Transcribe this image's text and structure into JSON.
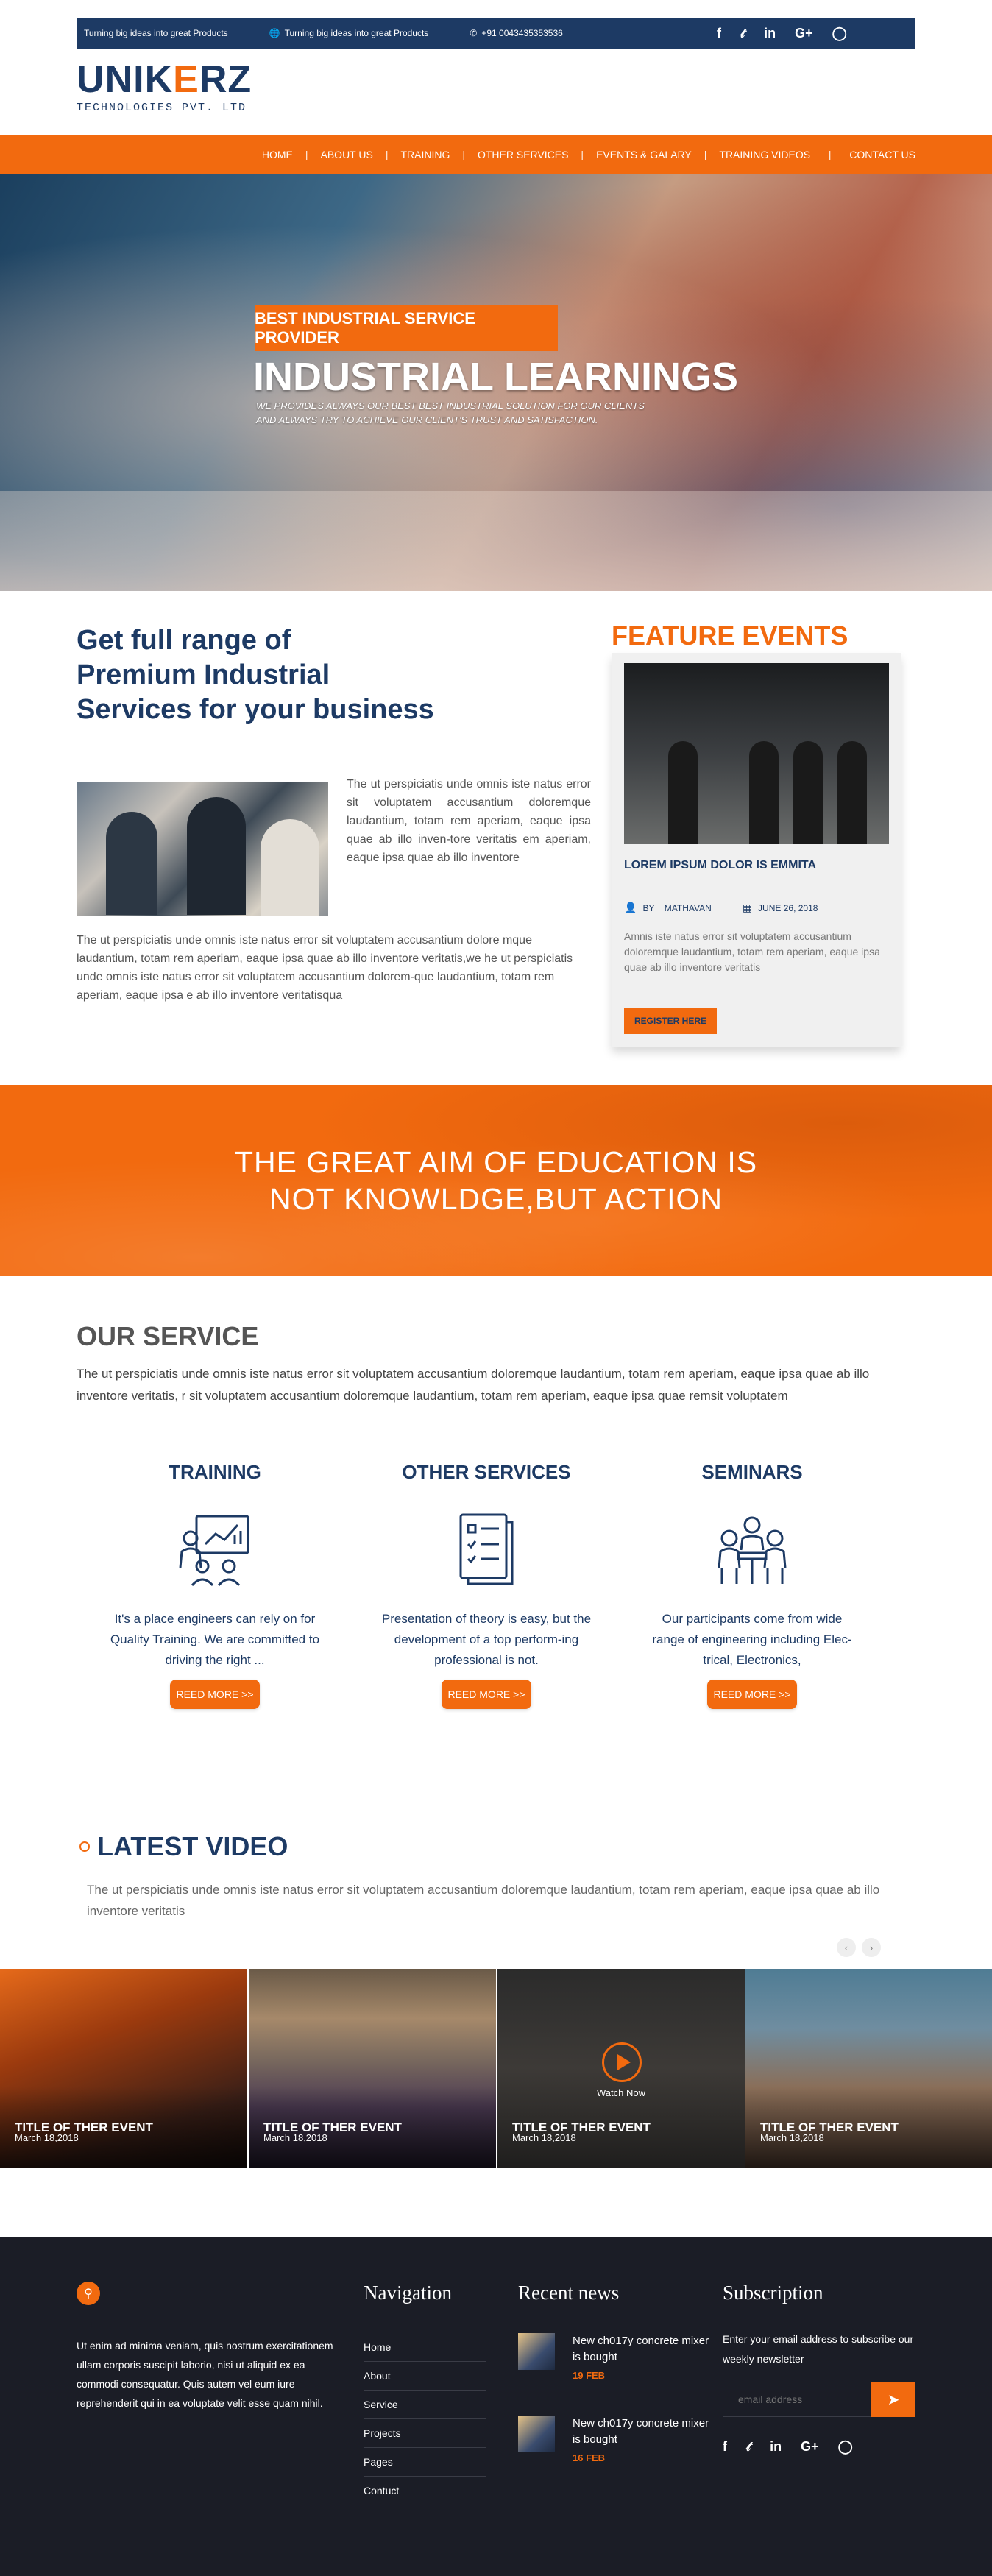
{
  "topbar": {
    "tagline_1": "Turning big ideas into great Products",
    "tagline_2": "Turning big ideas into great Products",
    "phone": "+91 0043435353536",
    "globe_icon": "globe-icon",
    "phone_icon": "phone-icon",
    "social": [
      "facebook-icon",
      "twitter-icon",
      "linkedin-icon",
      "google-plus-icon",
      "instagram-icon"
    ]
  },
  "logo": {
    "prefix": "U",
    "brand_a": "NIK",
    "brand_b": "E",
    "brand_c": "RZ",
    "subtitle": "TECHNOLOGIES PVT. LTD"
  },
  "nav": {
    "items": [
      "HOME",
      "ABOUT US",
      "TRAINING",
      "OTHER SERVICES",
      "EVENTS & GALARY",
      "TRAINING VIDEOS",
      "CONTACT US"
    ]
  },
  "hero": {
    "badge": "BEST INDUSTRIAL SERVICE PROVIDER",
    "title": "INDUSTRIAL LEARNINGS",
    "subtitle_1": "WE PROVIDES ALWAYS OUR BEST BEST INDUSTRIAL SOLUTION FOR OUR CLIENTS",
    "subtitle_2": "AND ALWAYS TRY TO ACHIEVE OUR CLIENT'S TRUST AND SATISFACTION."
  },
  "intro": {
    "title_1": "Get full range of",
    "title_2": "Premium Industrial",
    "title_3": "Services for your business",
    "side_text": "The ut perspiciatis unde omnis iste natus error sit voluptatem accusantium doloremque laudantium, totam rem aperiam, eaque ipsa quae ab illo inven-tore veritatis em aperiam, eaque ipsa quae ab illo inventore",
    "paragraph": "The ut perspiciatis unde omnis iste natus error sit voluptatem accusantium dolore mque laudantium, totam rem aperiam, eaque ipsa quae ab illo inventore veritatis,we he ut perspiciatis unde omnis iste natus error sit voluptatem accusantium dolorem-que laudantium, totam rem aperiam, eaque ipsa e ab illo inventore veritatisqua"
  },
  "feature": {
    "title": "FEATURE EVENTS",
    "heading": "LOREM IPSUM DOLOR IS EMMITA",
    "by_label": "BY",
    "author": "MATHAVAN",
    "date": "JUNE 26, 2018",
    "user_icon": "user-icon",
    "calendar_icon": "calendar-icon",
    "description": "Amnis iste natus error sit voluptatem accusantium doloremque laudantium, totam rem aperiam, eaque ipsa quae ab illo inventore veritatis",
    "button": "REGISTER HERE"
  },
  "quote": {
    "line_1": "THE GREAT AIM OF EDUCATION IS",
    "line_2": "NOT KNOWLDGE,BUT ACTION"
  },
  "services": {
    "title": "OUR SERVICE",
    "intro": "The ut perspiciatis unde omnis iste natus error sit voluptatem accusantium doloremque laudantium, totam rem aperiam, eaque ipsa quae ab illo inventore veritatis, r sit voluptatem accusantium doloremque laudantium, totam rem aperiam, eaque ipsa quae remsit voluptatem",
    "items": [
      {
        "title": "TRAINING",
        "icon": "training-icon",
        "text": "It's a place engineers can rely on for Quality Training. We are committed to driving the right ...",
        "button": "REED MORE >>"
      },
      {
        "title": "OTHER SERVICES",
        "icon": "checklist-icon",
        "text": "Presentation of theory is easy, but the development of a top perform-ing professional is not.",
        "button": "REED MORE >>"
      },
      {
        "title": "SEMINARS",
        "icon": "seminar-icon",
        "text": "Our participants come from wide range of engineering including Elec-trical, Electronics,",
        "button": "REED MORE >>"
      }
    ]
  },
  "videos": {
    "title": "LATEST VIDEO",
    "intro": "The ut perspiciatis unde omnis iste natus error sit voluptatem accusantium doloremque laudantium, totam rem aperiam, eaque ipsa quae ab illo inventore veritatis",
    "prev": "‹",
    "next": "›",
    "watch_label": "Watch Now",
    "items": [
      {
        "title": "TITLE OF THER EVENT",
        "date": "March 18,2018"
      },
      {
        "title": "TITLE OF THER EVENT",
        "date": "March 18,2018"
      },
      {
        "title": "TITLE OF THER EVENT",
        "date": "March 18,2018"
      },
      {
        "title": "TITLE OF THER EVENT",
        "date": "March 18,2018"
      }
    ]
  },
  "footer": {
    "about": "Ut enim ad minima veniam, quis nostrum exercitationem ullam corporis suscipit laborio, nisi ut aliquid ex ea commodi consequatur. Quis autem vel eum iure reprehenderit qui in ea voluptate velit esse quam nihil.",
    "nav_title": "Navigation",
    "nav_items": [
      "Home",
      "About",
      "Service",
      "Projects",
      "Pages",
      "Contuct"
    ],
    "news_title": "Recent news",
    "news": [
      {
        "title": "New ch017y concrete mixer is bought",
        "date": "19 FEB"
      },
      {
        "title": "New ch017y concrete mixer is bought",
        "date": "16 FEB"
      }
    ],
    "sub_title": "Subscription",
    "sub_text": "Enter your email address to subscribe our weekly newsletter",
    "email_placeholder": "email address"
  }
}
